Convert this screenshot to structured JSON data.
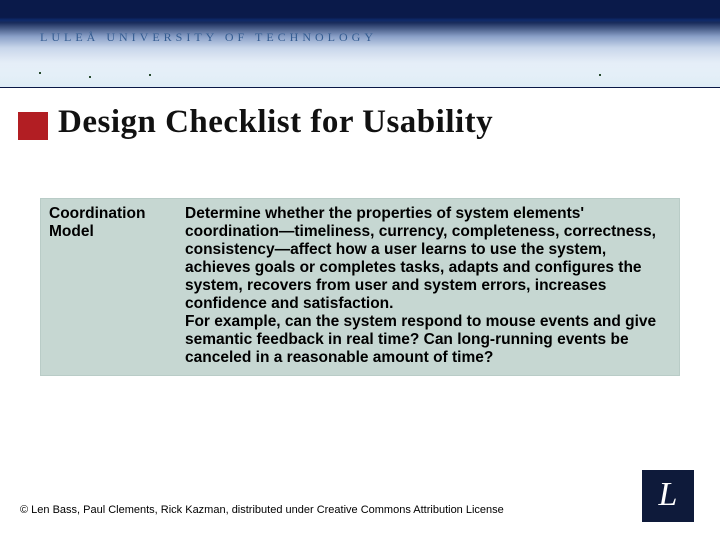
{
  "header": {
    "university": "LULEÅ UNIVERSITY OF TECHNOLOGY"
  },
  "title": "Design Checklist for Usability",
  "table": {
    "label": "Coordination Model",
    "body": "Determine whether the properties of system elements' coordination—timeliness, currency, completeness, correctness, consistency—affect how a user learns to use the system, achieves goals or completes tasks, adapts and configures the system, recovers from user and system errors, increases confidence and satisfaction.\nFor example, can the system respond to mouse events and give semantic feedback in real time? Can long-running events be canceled in a reasonable amount of time?"
  },
  "credit": "© Len Bass, Paul Clements, Rick Kazman, distributed under Creative Commons Attribution License",
  "logo": {
    "letter": "L"
  }
}
